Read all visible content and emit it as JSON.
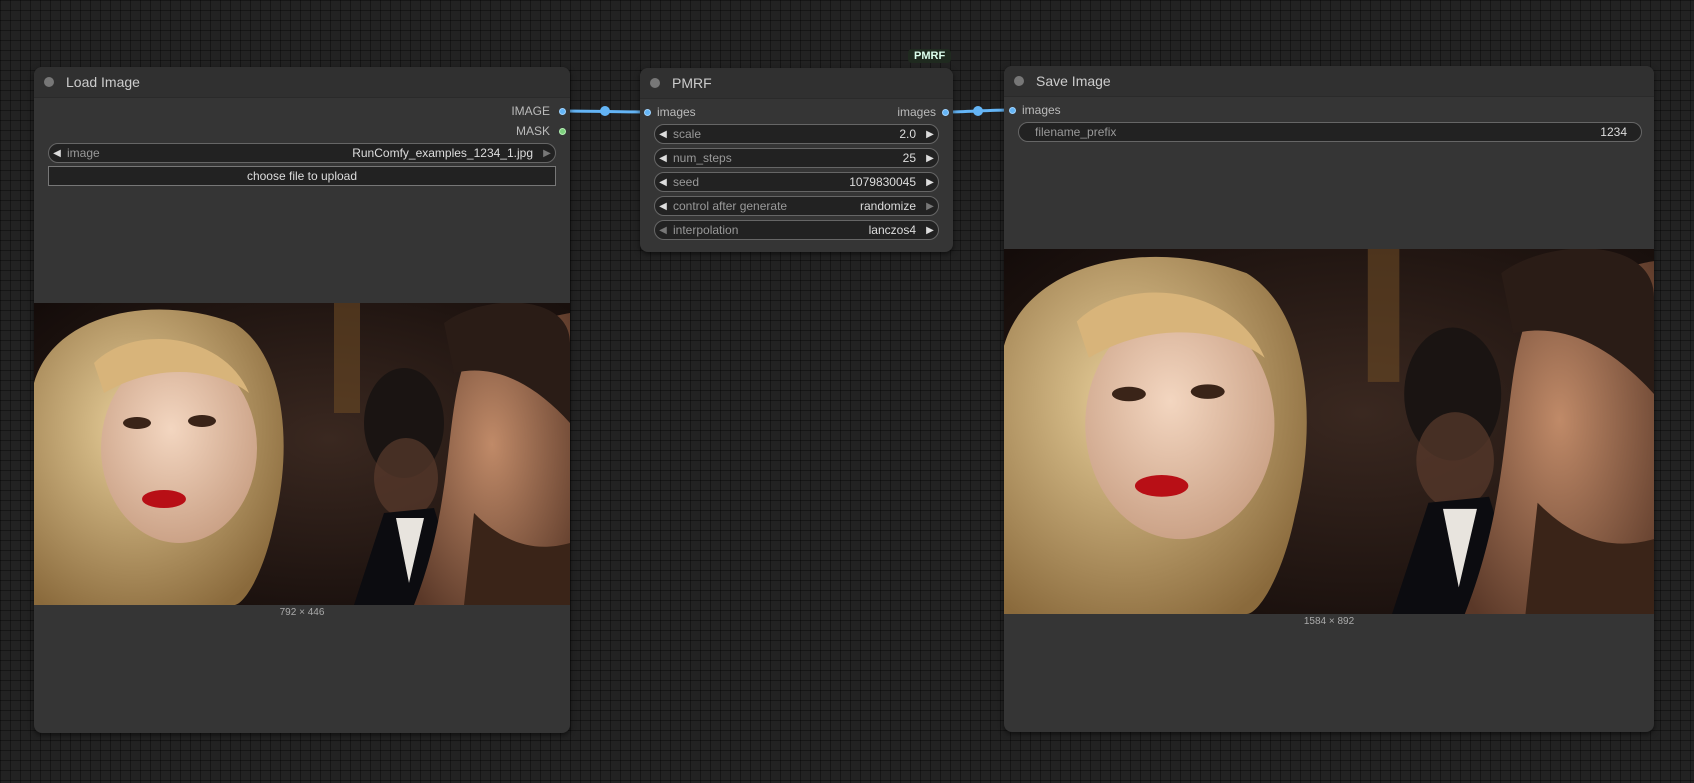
{
  "load_node": {
    "title": "Load Image",
    "outputs": [
      "IMAGE",
      "MASK"
    ],
    "image_widget": {
      "label": "image",
      "value": "RunComfy_examples_1234_1.jpg"
    },
    "upload_button": "choose file to upload",
    "image_size": "792 × 446"
  },
  "pmrf_node": {
    "title": "PMRF",
    "badge": "PMRF",
    "input": "images",
    "output": "images",
    "widgets": [
      {
        "label": "scale",
        "value": "2.0"
      },
      {
        "label": "num_steps",
        "value": "25"
      },
      {
        "label": "seed",
        "value": "1079830045"
      },
      {
        "label": "control after generate",
        "value": "randomize"
      },
      {
        "label": "interpolation",
        "value": "lanczos4"
      }
    ]
  },
  "save_node": {
    "title": "Save Image",
    "input": "images",
    "prefix_widget": {
      "label": "filename_prefix",
      "value": "1234"
    },
    "image_size": "1584 × 892"
  },
  "colors": {
    "canvas": "#222222",
    "node_body": "#353535",
    "link_image": "#64b5f6",
    "slot_mask": "#7ed07e"
  }
}
